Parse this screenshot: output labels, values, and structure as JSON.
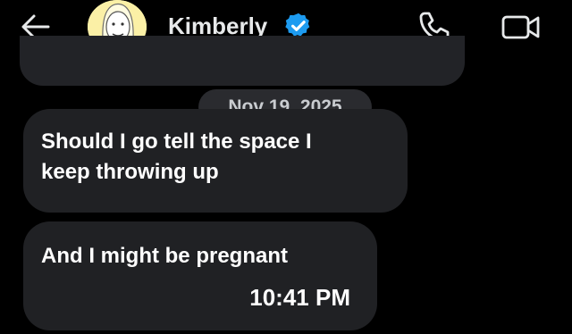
{
  "header": {
    "contact_name": "Kimberly",
    "back_icon": "arrow-left-icon",
    "verified_icon": "verified-badge-icon",
    "call_icon": "phone-icon",
    "video_icon": "video-camera-icon",
    "verified_color": "#1d9bf0"
  },
  "conversation": {
    "date_separator": "Nov 19, 2025",
    "messages": [
      {
        "lines": [
          "Should I go tell the space I",
          "keep throwing up"
        ]
      },
      {
        "lines": [
          "And I might be pregnant"
        ],
        "time": "10:41 PM"
      }
    ]
  },
  "colors": {
    "background": "#000000",
    "bubble": "#202124",
    "text": "#ffffff"
  }
}
